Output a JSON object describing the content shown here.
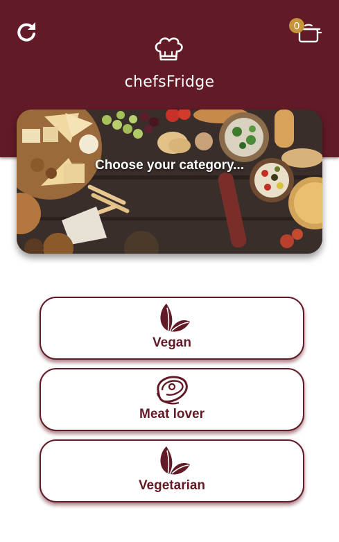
{
  "header": {
    "title": "chefsFridge",
    "background_color": "#621a26",
    "refresh_icon": "refresh-icon",
    "logo_icon": "chef-hat-icon"
  },
  "cart": {
    "count": "0",
    "icon": "cooking-pot-icon",
    "badge_color": "#c6953a"
  },
  "banner": {
    "text": "Choose your category..."
  },
  "categories": [
    {
      "label": "Vegan",
      "icon": "leaf-icon"
    },
    {
      "label": "Meat lover",
      "icon": "steak-icon"
    },
    {
      "label": "Vegetarian",
      "icon": "leaf-icon"
    }
  ],
  "theme": {
    "accent": "#621a26"
  }
}
